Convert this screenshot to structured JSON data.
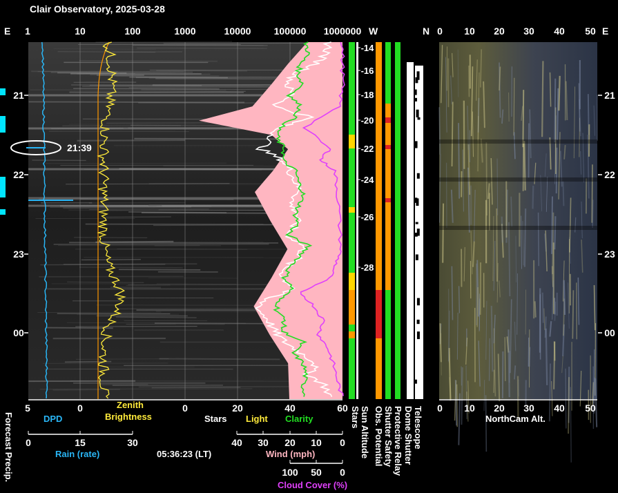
{
  "chart_data": {
    "type": "line",
    "title": "Clair Observatory, 2025-03-28",
    "top_axis": {
      "left_label": "E",
      "right_label": "W",
      "ticks": [
        "1",
        "10",
        "100",
        "1000",
        "10000",
        "100000",
        "1000000"
      ],
      "log_scale": true
    },
    "time_ticks": [
      "21",
      "22",
      "23",
      "00"
    ],
    "sun_altitude_ticks": [
      "-14",
      "-16",
      "-18",
      "-20",
      "-22",
      "-24",
      "-26",
      "-28"
    ],
    "northcam_axis": {
      "left_label": "N",
      "ticks": [
        "0",
        "10",
        "20",
        "30",
        "40",
        "50"
      ],
      "right_label": "E",
      "xlabel": "NorthCam Alt."
    },
    "annotation": {
      "label": "21:39"
    },
    "bottom_axes": {
      "dpd": {
        "label": "DPD",
        "ticks": [
          "5",
          "0"
        ],
        "color": "#29b6f6"
      },
      "zenith": {
        "label_line1": "Zenith",
        "label_line2": "Brightness",
        "color": "#ffeb3b"
      },
      "rain": {
        "label": "Rain (rate)",
        "ticks": [
          "0",
          "15",
          "30"
        ],
        "color": "#29b6f6"
      },
      "stars_light_clarity": {
        "ticks": [
          "0",
          "20",
          "40",
          "60"
        ],
        "labels": [
          "Stars",
          "Light",
          "Clarity"
        ],
        "colors": [
          "#ffffff",
          "#ffeb3b",
          "#22dd22"
        ]
      },
      "wind": {
        "label": "Wind (mph)",
        "ticks": [
          "40",
          "30",
          "20",
          "10",
          "0"
        ],
        "color": "#ffb6c1"
      },
      "cloud": {
        "label": "Cloud Cover (%)",
        "ticks": [
          "100",
          "50",
          "0"
        ],
        "color": "#e040fb"
      },
      "time_lt": "05:36:23 (LT)",
      "forecast_precip": "Forecast Precip.",
      "strip_labels": [
        "Stars",
        "Sun Altitude",
        "Obs. Potential",
        "Shutter Safety",
        "Protective Relay",
        "Dome Shutter",
        "Telescope"
      ]
    },
    "series": [
      {
        "name": "Stars",
        "color": "#ffffff",
        "x": [
          0,
          0.03,
          0.06,
          0.09,
          0.12,
          0.15,
          0.18,
          0.21,
          0.24,
          0.27,
          0.3,
          0.33,
          0.36,
          0.39,
          0.42,
          0.45,
          0.48,
          0.51,
          0.54,
          0.57,
          0.6,
          0.63,
          0.66,
          0.69,
          0.72,
          0.75,
          0.78,
          0.81,
          0.84,
          0.87,
          0.9,
          0.93,
          0.96,
          1.0
        ],
        "y": [
          55,
          54,
          50,
          42,
          39,
          41,
          34,
          48,
          35,
          33,
          29,
          37,
          40,
          42,
          44,
          40,
          43,
          42,
          39,
          45,
          44,
          38,
          37,
          42,
          30,
          28,
          32,
          34,
          38,
          44,
          50,
          47,
          53,
          56
        ]
      },
      {
        "name": "Clarity",
        "color": "#22dd22",
        "x": [
          0,
          0.03,
          0.06,
          0.09,
          0.12,
          0.15,
          0.18,
          0.21,
          0.24,
          0.27,
          0.3,
          0.33,
          0.36,
          0.39,
          0.42,
          0.45,
          0.48,
          0.51,
          0.54,
          0.57,
          0.6,
          0.63,
          0.66,
          0.69,
          0.72,
          0.75,
          0.78,
          0.81,
          0.84,
          0.87,
          0.9,
          0.93,
          0.96,
          1.0
        ],
        "y": [
          46,
          47,
          44,
          43,
          45,
          40,
          44,
          42,
          36,
          35,
          38,
          37,
          42,
          43,
          45,
          44,
          42,
          43,
          39,
          47,
          44,
          40,
          38,
          41,
          36,
          35,
          38,
          37,
          45,
          41,
          45,
          46,
          45,
          46
        ]
      },
      {
        "name": "Cloud Cover",
        "color": "#e040fb",
        "x": [
          0,
          0.06,
          0.12,
          0.18,
          0.24,
          0.3,
          0.33,
          0.36,
          0.42,
          0.5,
          0.58,
          0.62,
          0.66,
          0.7,
          0.74,
          0.78,
          0.82,
          0.86,
          0.9,
          0.95,
          1.0
        ],
        "y": [
          0,
          0,
          0,
          2,
          24,
          8,
          14,
          5,
          3,
          2,
          1,
          4,
          8,
          27,
          18,
          12,
          15,
          9,
          6,
          3,
          0
        ]
      },
      {
        "name": "Wind",
        "color": "#ffb6c1",
        "x": [
          0,
          0.06,
          0.12,
          0.18,
          0.22,
          0.26,
          0.3,
          0.36,
          0.42,
          0.5,
          0.58,
          0.66,
          0.74,
          0.82,
          0.9,
          1.0
        ],
        "y": [
          2,
          3,
          4,
          5,
          8,
          4,
          3,
          4,
          5,
          4,
          3,
          4,
          5,
          4,
          3,
          3
        ]
      }
    ]
  },
  "colors": {
    "background": "#000000",
    "dpd": "#29b6f6",
    "zenith": "#ffeb3b",
    "stars": "#ffffff",
    "clarity": "#22dd22",
    "cloud": "#e040fb",
    "wind": "#ffb6c1"
  }
}
